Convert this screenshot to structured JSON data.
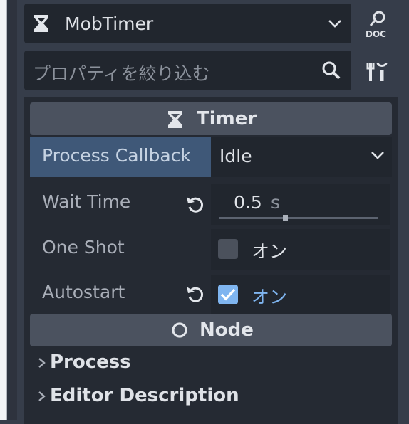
{
  "node_selector": {
    "name": "MobTimer",
    "icon": "hourglass-icon"
  },
  "filter": {
    "placeholder": "プロパティを絞り込む",
    "icon": "search-icon"
  },
  "sections": {
    "timer": {
      "title": "Timer",
      "icon": "hourglass-icon"
    },
    "node": {
      "title": "Node",
      "icon": "node-circle-icon"
    }
  },
  "properties": {
    "process_callback": {
      "label": "Process Callback",
      "value": "Idle"
    },
    "wait_time": {
      "label": "Wait Time",
      "value": "0.5",
      "unit": "s",
      "slider_fraction": 0.4
    },
    "one_shot": {
      "label": "One Shot",
      "checked": false,
      "state_text": "オン"
    },
    "autostart": {
      "label": "Autostart",
      "checked": true,
      "state_text": "オン"
    }
  },
  "categories": {
    "process": "Process",
    "editor_description": "Editor Description"
  },
  "colors": {
    "accent": "#7fb5f0",
    "selected_label_bg": "#3f5878",
    "header_bg": "#4b525f"
  }
}
